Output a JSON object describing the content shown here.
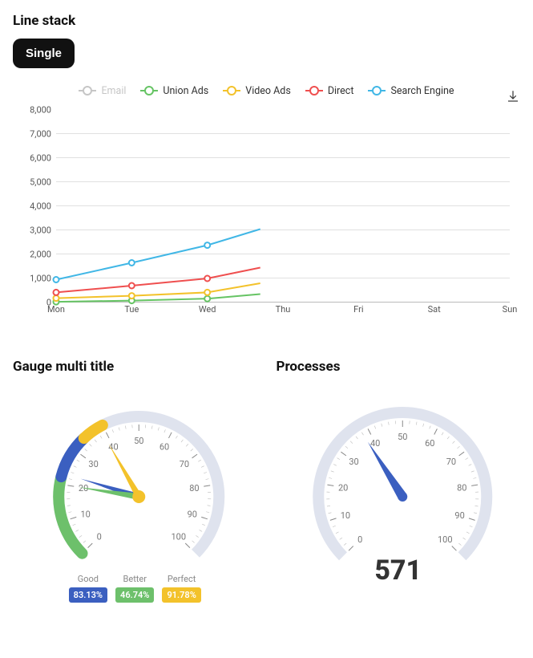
{
  "lineStack": {
    "title": "Line stack",
    "button": "Single",
    "downloadIcon": "download-icon",
    "legend": [
      {
        "name": "Email",
        "color": "#c6c6c6",
        "muted": true
      },
      {
        "name": "Union Ads",
        "color": "#66c464",
        "muted": false
      },
      {
        "name": "Video Ads",
        "color": "#f3c22b",
        "muted": false
      },
      {
        "name": "Direct",
        "color": "#ef4f4f",
        "muted": false
      },
      {
        "name": "Search Engine",
        "color": "#41b7e6",
        "muted": false
      }
    ]
  },
  "chart_data": [
    {
      "type": "line",
      "title": "Line stack",
      "categories": [
        "Mon",
        "Tue",
        "Wed",
        "Thu",
        "Fri",
        "Sat",
        "Sun"
      ],
      "ylim": [
        0,
        8000
      ],
      "yticks": [
        0,
        1000,
        2000,
        3000,
        4000,
        5000,
        6000,
        7000,
        8000
      ],
      "ytick_labels": [
        "0",
        "1,000",
        "2,000",
        "3,000",
        "4,000",
        "5,000",
        "6,000",
        "7,000",
        "8,000"
      ],
      "series": [
        {
          "name": "Email",
          "color": "#c6c6c6",
          "visible": false,
          "values": [
            null,
            null,
            null,
            null,
            null,
            null,
            null
          ]
        },
        {
          "name": "Union Ads",
          "color": "#66c464",
          "visible": true,
          "values": [
            30,
            80,
            160,
            null,
            null,
            null,
            null
          ],
          "last_segment_end": 350
        },
        {
          "name": "Video Ads",
          "color": "#f3c22b",
          "visible": true,
          "values": [
            180,
            280,
            420,
            null,
            null,
            null,
            null
          ],
          "last_segment_end": 800
        },
        {
          "name": "Direct",
          "color": "#ef4f4f",
          "visible": true,
          "values": [
            420,
            700,
            1000,
            null,
            null,
            null,
            null
          ],
          "last_segment_end": 1450
        },
        {
          "name": "Search Engine",
          "color": "#41b7e6",
          "visible": true,
          "values": [
            950,
            1650,
            2380,
            null,
            null,
            null,
            null
          ],
          "last_segment_end": 3050
        }
      ]
    },
    {
      "type": "gauge",
      "title": "Gauge multi title",
      "min": 0,
      "max": 100,
      "ticks": [
        0,
        10,
        20,
        30,
        40,
        50,
        60,
        70,
        80,
        90,
        100
      ],
      "series": [
        {
          "name": "Good",
          "color": "#3b5fc0",
          "value": 83.13,
          "pointer_target": 23
        },
        {
          "name": "Better",
          "color": "#6dc06b",
          "value": 46.74,
          "pointer_target": 20
        },
        {
          "name": "Perfect",
          "color": "#f3c22b",
          "value": 91.78,
          "pointer_target": 39
        }
      ]
    },
    {
      "type": "gauge",
      "title": "Processes",
      "min": 0,
      "max": 100,
      "ticks": [
        0,
        10,
        20,
        30,
        40,
        50,
        60,
        70,
        80,
        90,
        100
      ],
      "value_display": "571",
      "pointer_target": 38,
      "pointer_color": "#3b5fc0"
    }
  ],
  "gaugeMulti": {
    "title": "Gauge multi title",
    "labels": [
      {
        "t": "Good",
        "v": "83.13%",
        "bg": "#3b5fc0"
      },
      {
        "t": "Better",
        "v": "46.74%",
        "bg": "#6dc06b"
      },
      {
        "t": "Perfect",
        "v": "91.78%",
        "bg": "#f3c22b"
      }
    ]
  },
  "processes": {
    "title": "Processes",
    "value": "571"
  }
}
